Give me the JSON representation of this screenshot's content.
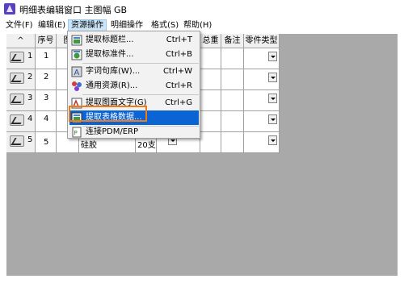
{
  "window": {
    "title": "明细表编辑窗口 主图幅 GB"
  },
  "menubar": {
    "items": [
      {
        "label": "文件(F)"
      },
      {
        "label": "编辑(E)"
      },
      {
        "label": "资源操作"
      },
      {
        "label": "明细操作"
      },
      {
        "label": "格式(S)"
      },
      {
        "label": "帮助(H)"
      }
    ]
  },
  "grid": {
    "corner": "^",
    "columns": [
      "序号",
      "图",
      "",
      "",
      "",
      "总重",
      "备注",
      "零件类型"
    ],
    "rows": [
      {
        "index": "1",
        "seq": "1",
        "name": "",
        "qty": ""
      },
      {
        "index": "2",
        "seq": "2",
        "name": "",
        "qty": ""
      },
      {
        "index": "3",
        "seq": "3",
        "name": "",
        "qty": ""
      },
      {
        "index": "4",
        "seq": "4",
        "name": "",
        "qty": ""
      },
      {
        "index": "5",
        "seq": "5",
        "name": "硅胶",
        "qty": "20支"
      }
    ]
  },
  "popup_menu": {
    "items": [
      {
        "label": "提取标题栏...",
        "shortcut": "Ctrl+T",
        "icon": "title-block-icon"
      },
      {
        "label": "提取标准件...",
        "shortcut": "Ctrl+B",
        "icon": "standard-part-icon"
      },
      {
        "label": "字词句库(W)...",
        "shortcut": "Ctrl+W",
        "icon": "text-library-icon"
      },
      {
        "label": "通用资源(R)...",
        "shortcut": "Ctrl+R",
        "icon": "resource-icon"
      },
      {
        "label": "提取图面文字(G)",
        "shortcut": "Ctrl+G",
        "icon": "extract-text-icon"
      },
      {
        "label": "提取表格数据...",
        "shortcut": "",
        "icon": "table-data-icon"
      },
      {
        "label": "连接PDM/ERP",
        "shortcut": "",
        "icon": "pdm-erp-icon"
      }
    ],
    "highlighted_index": 5
  },
  "colors": {
    "highlight": "#0a64d4",
    "outline": "#f07a1a",
    "grid_background": "#a9a9a9"
  }
}
